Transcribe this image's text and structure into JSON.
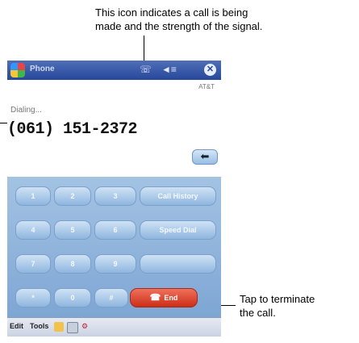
{
  "callouts": {
    "top_line1": "This icon indicates a call is being",
    "top_line2": "made and the strength of the signal.",
    "bottom_line1": "Tap to terminate",
    "bottom_line2": "the call."
  },
  "window": {
    "title": "Phone",
    "icons": [
      "start-menu-icon",
      "call-signal-icon",
      "speaker-icon",
      "close-icon"
    ]
  },
  "call": {
    "carrier": "AT&T",
    "status": "Dialing...",
    "number": "(061) 151-2372"
  },
  "keypad": {
    "keys": [
      "1",
      "2",
      "3",
      "4",
      "5",
      "6",
      "7",
      "8",
      "9",
      "*",
      "0",
      "#"
    ],
    "call_history": "Call History",
    "speed_dial": "Speed Dial",
    "end": "End"
  },
  "menubar": {
    "edit": "Edit",
    "tools": "Tools"
  }
}
